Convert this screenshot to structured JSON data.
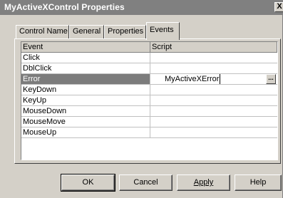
{
  "window": {
    "title": "MyActiveXControl Properties",
    "close_glyph": "X"
  },
  "tabs": [
    {
      "label": "Control Name"
    },
    {
      "label": "General"
    },
    {
      "label": "Properties"
    },
    {
      "label": "Events",
      "active": true
    }
  ],
  "grid": {
    "columns": [
      "Event",
      "Script"
    ],
    "rows": [
      {
        "event": "Click",
        "script": ""
      },
      {
        "event": "DblClick",
        "script": ""
      },
      {
        "event": "Error",
        "script": "MyActiveXError",
        "selected": true
      },
      {
        "event": "KeyDown",
        "script": ""
      },
      {
        "event": "KeyUp",
        "script": ""
      },
      {
        "event": "MouseDown",
        "script": ""
      },
      {
        "event": "MouseMove",
        "script": ""
      },
      {
        "event": "MouseUp",
        "script": ""
      }
    ],
    "ellipsis_label": "..."
  },
  "buttons": {
    "ok": "OK",
    "cancel": "Cancel",
    "apply": "Apply",
    "help": "Help"
  }
}
